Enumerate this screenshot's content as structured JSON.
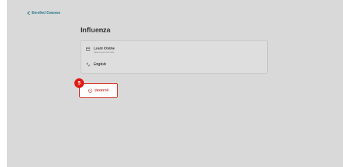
{
  "nav": {
    "back_label": "Enrolled Courses",
    "back_icon": "chevron-left-icon"
  },
  "course": {
    "title": "Influenza",
    "mode": {
      "icon": "calendar-icon",
      "label": "Learn Online",
      "sublabel": "Take at your own pace"
    },
    "language": {
      "icon": "translate-icon",
      "label": "English"
    }
  },
  "actions": {
    "unenroll_label": "Unenroll",
    "unenroll_icon": "minus-circle-icon"
  },
  "annotation": {
    "step_number": "5"
  },
  "colors": {
    "background": "#d9d9d9",
    "accent_link": "#1e6f86",
    "danger": "#d9382c",
    "badge": "#e01b16"
  }
}
